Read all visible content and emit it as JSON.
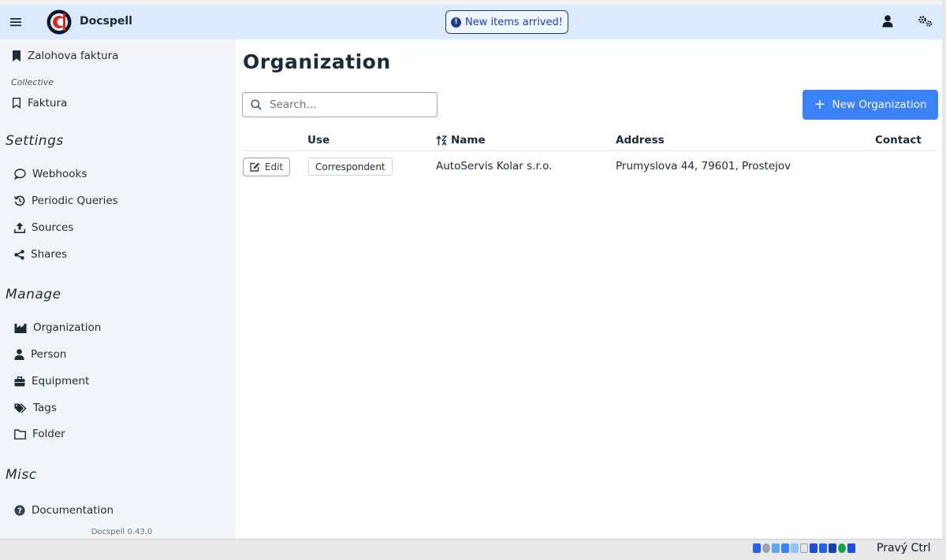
{
  "topbar": {
    "brand": "Docspell",
    "notification": "New items arrived!"
  },
  "sidebar": {
    "bookmark": "Zalohova faktura",
    "collective_label": "Collective",
    "collective_item": "Faktura",
    "settings_heading": "Settings",
    "settings_items": [
      "Webhooks",
      "Periodic Queries",
      "Sources",
      "Shares"
    ],
    "manage_heading": "Manage",
    "manage_items": [
      "Organization",
      "Person",
      "Equipment",
      "Tags",
      "Folder"
    ],
    "misc_heading": "Misc",
    "misc_items": [
      "Documentation"
    ],
    "version": "Docspell 0.43.0"
  },
  "main": {
    "title": "Organization",
    "search_placeholder": "Search…",
    "new_button": "New Organization",
    "columns": [
      "Use",
      "Name",
      "Address",
      "Contact"
    ],
    "rows": [
      {
        "edit_label": "Edit",
        "use": "Correspondent",
        "name": "AutoServis Kolar s.r.o.",
        "address": "Prumyslova 44, 79601, Prostejov",
        "contact": ""
      }
    ]
  },
  "statusbar": {
    "host_key": "Pravý Ctrl"
  },
  "colors": {
    "topbar_bg": "#dbeafe",
    "sidebar_bg": "#f1f5f9",
    "primary_button": "#3b82f6",
    "notification_border": "#1e3a8a"
  }
}
